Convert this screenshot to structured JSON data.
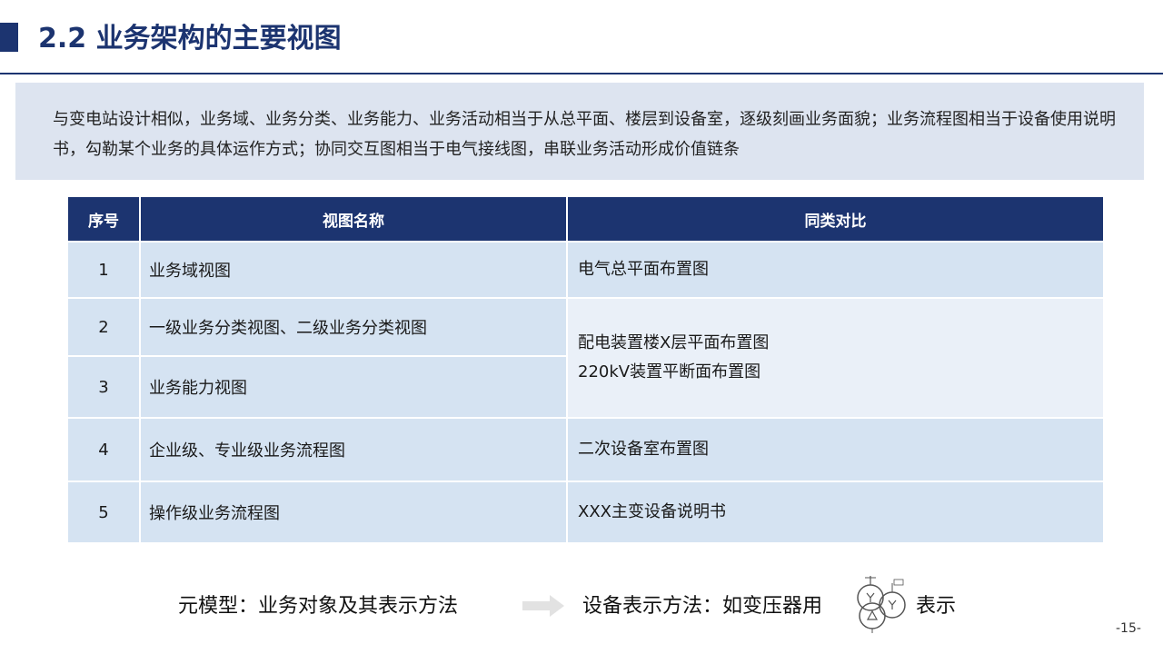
{
  "header": {
    "title": "2.2 业务架构的主要视图",
    "accent_color": "#1c3470"
  },
  "summary": {
    "text": "与变电站设计相似，业务域、业务分类、业务能力、业务活动相当于从总平面、楼层到设备室，逐级刻画业务面貌；业务流程图相当于设备使用说明书，勾勒某个业务的具体运作方式；协同交互图相当于电气接线图，串联业务活动形成价值链条"
  },
  "table": {
    "headers": [
      "序号",
      "视图名称",
      "同类对比"
    ],
    "rows": [
      {
        "num": "1",
        "name": "业务域视图",
        "compare": "电气总平面布置图"
      },
      {
        "num": "2",
        "name": "一级业务分类视图、二级业务分类视图",
        "compare_lines": [
          "配电装置楼X层平面布置图",
          "220kV装置平断面布置图"
        ]
      },
      {
        "num": "3",
        "name": "业务能力视图"
      },
      {
        "num": "4",
        "name": "企业级、专业级业务流程图",
        "compare": "二次设备室布置图"
      },
      {
        "num": "5",
        "name": "操作级业务流程图",
        "compare": "XXX主变设备说明书"
      }
    ]
  },
  "footer": {
    "left_text": "元模型：业务对象及其表示方法",
    "right_text": "设备表示方法：如变压器用",
    "suffix_text": "表示",
    "icon": "transformer-symbol-icon",
    "arrow_icon": "arrow-right-icon"
  },
  "page": {
    "number": "-15-"
  }
}
